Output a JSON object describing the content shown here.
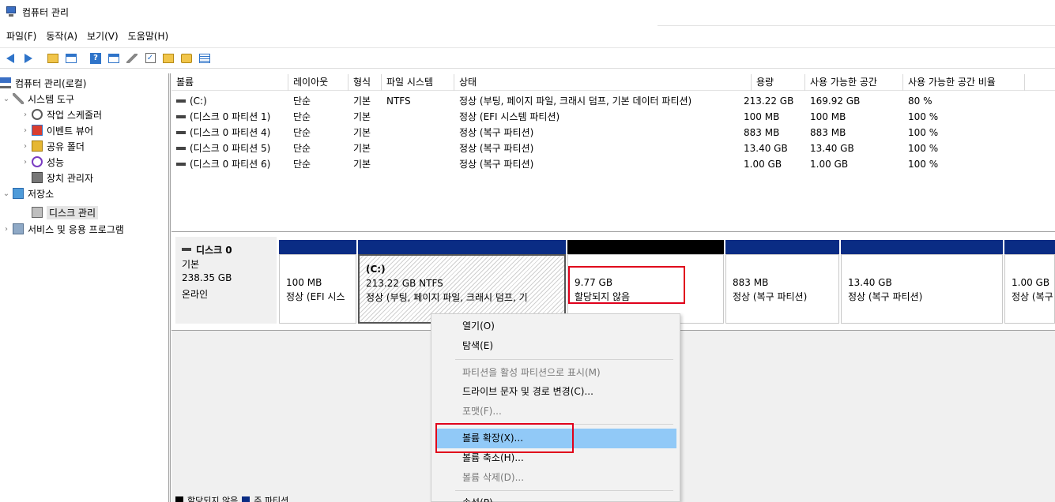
{
  "window": {
    "title": "컴퓨터 관리"
  },
  "menu": [
    "파일(F)",
    "동작(A)",
    "보기(V)",
    "도움말(H)"
  ],
  "toolbar_icons": [
    "back-arrow-icon",
    "forward-arrow-icon",
    "up-folder-icon",
    "show-hide-tree-icon",
    "help-icon",
    "properties-icon",
    "connect-icon",
    "check-icon",
    "folder-up-icon",
    "search-folder-icon",
    "list-view-icon"
  ],
  "tree": {
    "root": "컴퓨터 관리(로컬)",
    "system_tools": "시스템 도구",
    "task_scheduler": "작업 스케줄러",
    "event_viewer": "이벤트 뷰어",
    "shared_folders": "공유 폴더",
    "performance": "성능",
    "device_manager": "장치 관리자",
    "storage": "저장소",
    "disk_management": "디스크 관리",
    "services_apps": "서비스 및 응용 프로그램"
  },
  "volume_table": {
    "headers": [
      "볼륨",
      "레이아웃",
      "형식",
      "파일 시스템",
      "상태",
      "용량",
      "사용 가능한 공간",
      "사용 가능한 공간 비율"
    ],
    "rows": [
      [
        "(C:)",
        "단순",
        "기본",
        "NTFS",
        "정상 (부팅, 페이지 파일, 크래시 덤프, 기본 데이터 파티션)",
        "213.22 GB",
        "169.92 GB",
        "80 %"
      ],
      [
        "(디스크 0 파티션 1)",
        "단순",
        "기본",
        "",
        "정상 (EFI 시스템 파티션)",
        "100 MB",
        "100 MB",
        "100 %"
      ],
      [
        "(디스크 0 파티션 4)",
        "단순",
        "기본",
        "",
        "정상 (복구 파티션)",
        "883 MB",
        "883 MB",
        "100 %"
      ],
      [
        "(디스크 0 파티션 5)",
        "단순",
        "기본",
        "",
        "정상 (복구 파티션)",
        "13.40 GB",
        "13.40 GB",
        "100 %"
      ],
      [
        "(디스크 0 파티션 6)",
        "단순",
        "기본",
        "",
        "정상 (복구 파티션)",
        "1.00 GB",
        "1.00 GB",
        "100 %"
      ]
    ]
  },
  "disk": {
    "name": "디스크 0",
    "type": "기본",
    "size": "238.35 GB",
    "status": "온라인",
    "partitions": [
      {
        "l1": "100 MB",
        "l2": "정상 (EFI 시스",
        "bar": "blue"
      },
      {
        "l0": "(C:)",
        "l1": "213.22 GB NTFS",
        "l2": "정상 (부팅, 페이지 파일, 크래시 덤프, 기",
        "bar": "blue"
      },
      {
        "l1": "9.77 GB",
        "l2": "할당되지 않음",
        "bar": "black"
      },
      {
        "l1": "883 MB",
        "l2": "정상 (복구 파티션)",
        "bar": "blue"
      },
      {
        "l1": "13.40 GB",
        "l2": "정상 (복구 파티션)",
        "bar": "blue"
      },
      {
        "l1": "1.00 GB",
        "l2": "정상 (복구",
        "bar": "blue"
      }
    ]
  },
  "legend": {
    "unallocated": "할당되지 않음",
    "primary": "주 파티션"
  },
  "context_menu": {
    "open": "열기(O)",
    "explore": "탐색(E)",
    "mark_active": "파티션을 활성 파티션으로 표시(M)",
    "change_letter": "드라이브 문자 및 경로 변경(C)...",
    "format": "포맷(F)...",
    "extend": "볼륨 확장(X)...",
    "shrink": "볼륨 축소(H)...",
    "delete": "볼륨 삭제(D)...",
    "properties": "속성(P)"
  },
  "colors": {
    "primary_partition": "#0a2c84",
    "unallocated": "#000000",
    "highlight": "#e0001b",
    "menu_hover": "#91c9f7"
  }
}
